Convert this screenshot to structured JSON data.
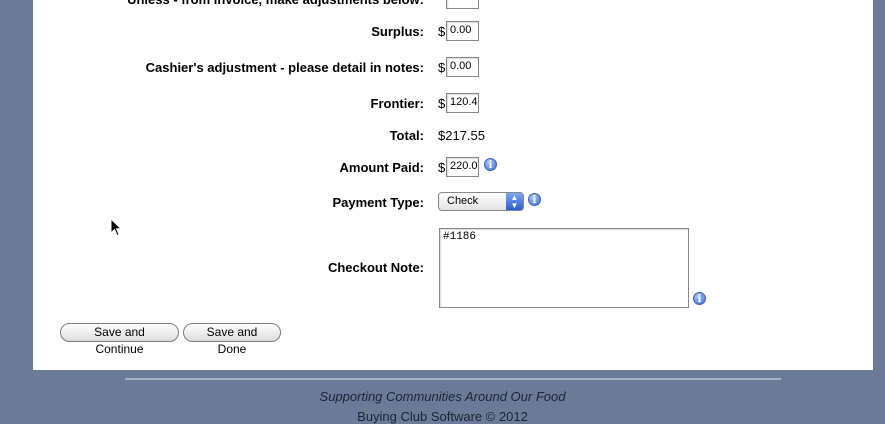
{
  "form": {
    "cutoff_label": "Unless - from invoice, make adjustments below:",
    "surplus_label": "Surplus:",
    "surplus_value": "0.00",
    "cashier_label": "Cashier's adjustment - please detail in notes:",
    "cashier_value": "0.00",
    "frontier_label": "Frontier:",
    "frontier_value": "120.4",
    "total_label": "Total:",
    "total_value": "$217.55",
    "amount_paid_label": "Amount Paid:",
    "amount_paid_value": "220.0",
    "payment_type_label": "Payment Type:",
    "payment_type_value": "Check",
    "checkout_note_label": "Checkout Note:",
    "checkout_note_value": "#1186",
    "currency_symbol": "$"
  },
  "buttons": {
    "save_continue": "Save and Continue",
    "save_done": "Save and Done"
  },
  "footer": {
    "tagline": "Supporting Communities Around Our Food",
    "copyright": "Buying Club Software © 2012"
  },
  "icons": {
    "info": "info-icon",
    "select_arrows": "up-down-arrows-icon",
    "cursor": "mouse-pointer-icon"
  },
  "colors": {
    "page_background": "#6b7a96",
    "panel_background": "#ffffff",
    "info_icon_blue": "#3f6fd3",
    "select_arrow_blue": "#2a5fd0"
  }
}
